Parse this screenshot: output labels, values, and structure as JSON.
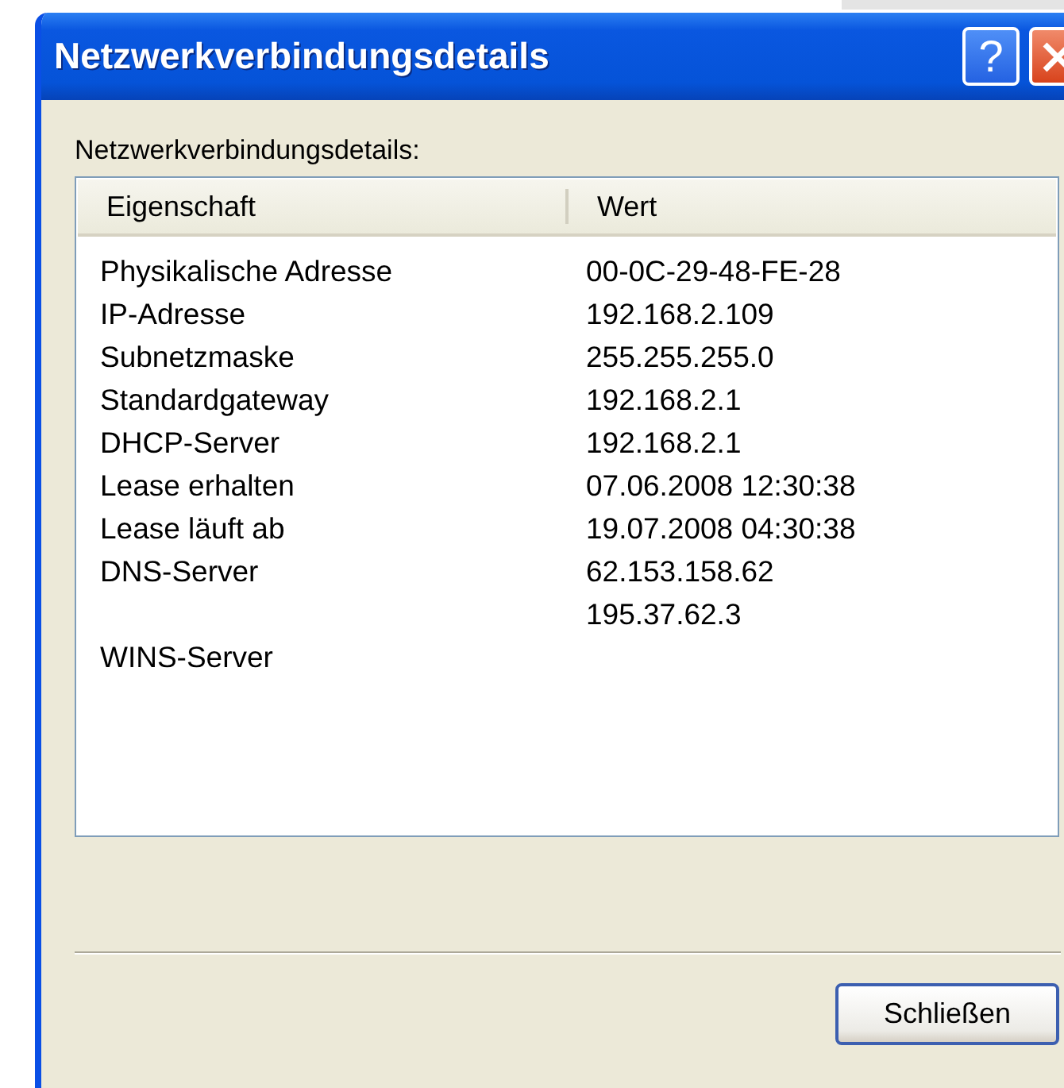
{
  "window": {
    "title": "Netzwerkverbindungsdetails",
    "buttons": [
      {
        "kind": "help",
        "label": "?"
      },
      {
        "kind": "close"
      }
    ]
  },
  "label": "Netzwerkverbindungsdetails:",
  "table": {
    "columns": [
      "Eigenschaft",
      "Wert"
    ],
    "rows": [
      {
        "property": "Physikalische Adresse",
        "value": "00-0C-29-48-FE-28"
      },
      {
        "property": "IP-Adresse",
        "value": "192.168.2.109"
      },
      {
        "property": "Subnetzmaske",
        "value": "255.255.255.0"
      },
      {
        "property": "Standardgateway",
        "value": "192.168.2.1"
      },
      {
        "property": "DHCP-Server",
        "value": "192.168.2.1"
      },
      {
        "property": "Lease erhalten",
        "value": "07.06.2008 12:30:38"
      },
      {
        "property": "Lease läuft ab",
        "value": "19.07.2008 04:30:38"
      },
      {
        "property": "DNS-Server",
        "value": "62.153.158.62"
      },
      {
        "value": "195.37.62.3"
      },
      {
        "property": "WINS-Server"
      }
    ]
  },
  "buttons": [
    "Schließen"
  ]
}
